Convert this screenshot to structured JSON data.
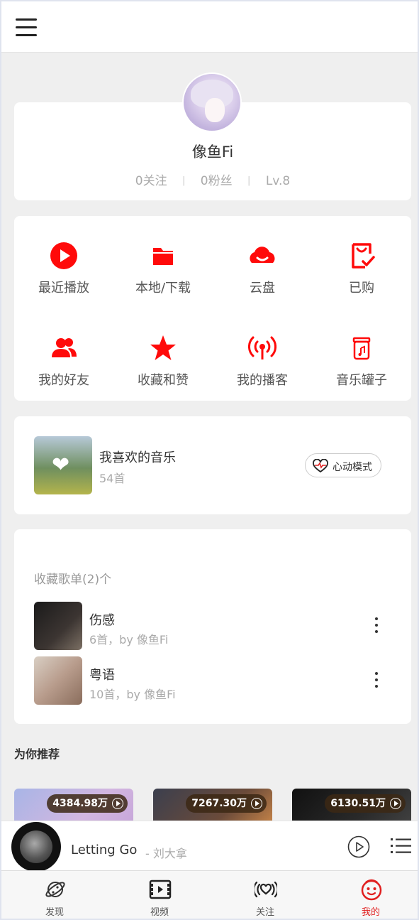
{
  "header": {
    "menu_icon": "hamburger-menu-icon"
  },
  "profile": {
    "username": "像鱼Fi",
    "following": "0关注",
    "fans": "0粉丝",
    "level": "Lv.8",
    "separator": "|"
  },
  "grid": {
    "items": [
      {
        "label": "最近播放",
        "icon": "recent-play-icon"
      },
      {
        "label": "本地/下载",
        "icon": "folder-icon"
      },
      {
        "label": "云盘",
        "icon": "cloud-icon"
      },
      {
        "label": "已购",
        "icon": "purchased-icon"
      },
      {
        "label": "我的好友",
        "icon": "friends-icon"
      },
      {
        "label": "收藏和赞",
        "icon": "star-icon"
      },
      {
        "label": "我的播客",
        "icon": "podcast-icon"
      },
      {
        "label": "音乐罐子",
        "icon": "music-jar-icon"
      }
    ],
    "accent": "#ff0a0a"
  },
  "liked": {
    "title": "我喜欢的音乐",
    "count": "54首",
    "heart_mode": "心动模式"
  },
  "playlists": {
    "header": "收藏歌单(2)个",
    "items": [
      {
        "title": "伤感",
        "sub": "6首，by 像鱼Fi"
      },
      {
        "title": "粤语",
        "sub": "10首，by 像鱼Fi"
      }
    ]
  },
  "recommend": {
    "title": "为你推荐",
    "cards": [
      {
        "plays": "4384.98万"
      },
      {
        "plays": "7267.30万"
      },
      {
        "plays": "6130.51万"
      }
    ]
  },
  "player": {
    "song": "Letting Go",
    "artist": "- 刘大拿"
  },
  "tabs": [
    {
      "label": "发现",
      "icon": "planet-icon"
    },
    {
      "label": "视频",
      "icon": "film-icon"
    },
    {
      "label": "关注",
      "icon": "broadcast-icon"
    },
    {
      "label": "我的",
      "icon": "smiley-icon",
      "active": true
    }
  ]
}
